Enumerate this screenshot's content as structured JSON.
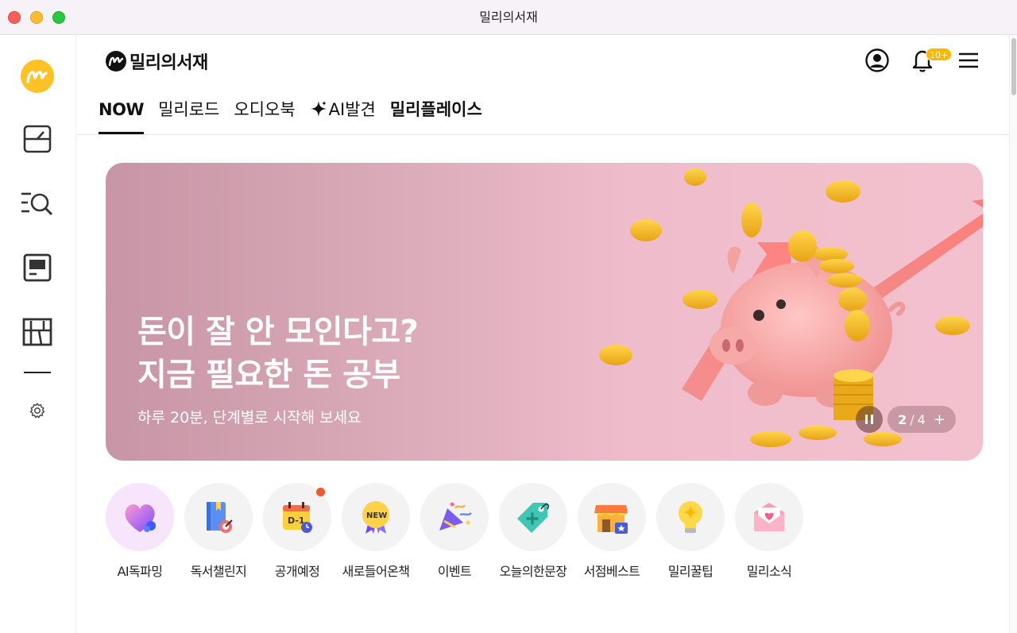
{
  "window": {
    "title": "밀리의서재"
  },
  "header": {
    "brand": "밀리의서재",
    "notification_badge": "10+"
  },
  "tabs": [
    {
      "label": "NOW",
      "active": true
    },
    {
      "label": "밀리로드"
    },
    {
      "label": "오디오북"
    },
    {
      "label": "AI발견"
    },
    {
      "label": "밀리플레이스"
    }
  ],
  "banner": {
    "title_line1": "돈이 잘 안 모인다고?",
    "title_line2": "지금 필요한 돈 공부",
    "subtitle": "하루 20분, 단계별로 시작해 보세요",
    "page_current": "2",
    "page_total": "4",
    "plus": "+"
  },
  "quick_menu": [
    {
      "label": "AI독파밍",
      "icon": "heart-icon"
    },
    {
      "label": "독서챌린지",
      "icon": "book-icon"
    },
    {
      "label": "공개예정",
      "icon": "calendar-icon",
      "new_dot": true
    },
    {
      "label": "새로들어온책",
      "icon": "new-badge-icon"
    },
    {
      "label": "이벤트",
      "icon": "party-icon"
    },
    {
      "label": "오늘의한문장",
      "icon": "tag-icon"
    },
    {
      "label": "서점베스트",
      "icon": "store-icon"
    },
    {
      "label": "밀리꿀팁",
      "icon": "lightbulb-icon"
    },
    {
      "label": "밀리소식",
      "icon": "mail-icon"
    }
  ],
  "colors": {
    "accent": "#ffc226",
    "badge": "#ffb800",
    "dot": "#ee5a2a",
    "banner_start": "#c795a5",
    "banner_end": "#f3c1ce"
  }
}
